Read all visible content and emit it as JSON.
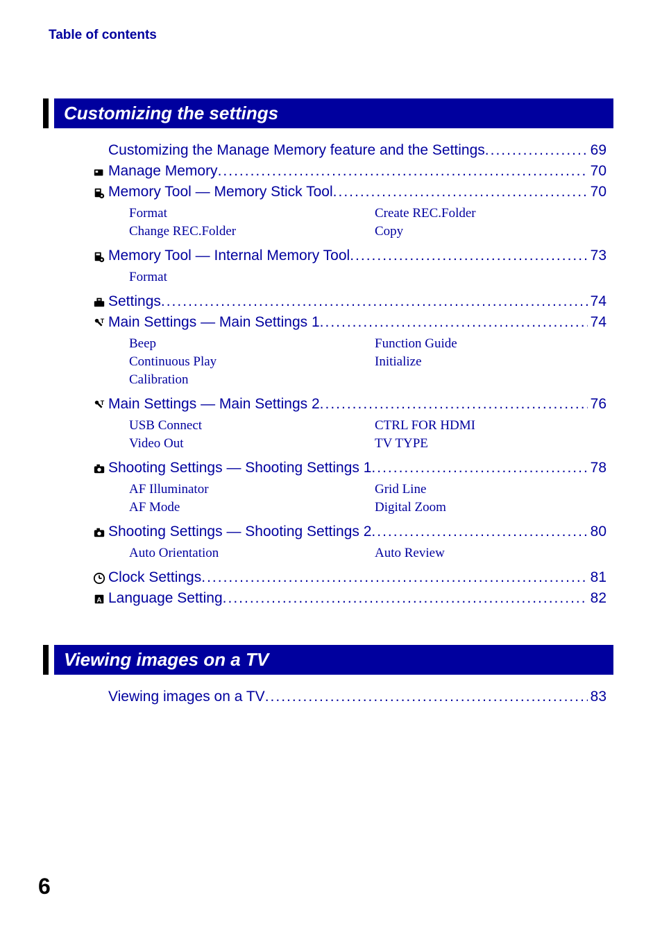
{
  "header": "Table of contents",
  "sections": [
    {
      "title": "Customizing the settings",
      "entries": [
        {
          "icon": "",
          "label": "Customizing the Manage Memory feature and the Settings",
          "page": "69",
          "link": true
        },
        {
          "icon": "memory-tab-icon",
          "label": "Manage Memory",
          "page": "70",
          "link": true
        },
        {
          "icon": "memory-tool-icon",
          "label": "Memory Tool — Memory Stick Tool",
          "page": "70",
          "link": true,
          "subs": [
            "Format",
            "Create REC.Folder",
            "Change REC.Folder",
            "Copy"
          ]
        },
        {
          "icon": "memory-tool-icon",
          "label": "Memory Tool — Internal Memory Tool",
          "page": "73",
          "link": true,
          "subs": [
            "Format",
            ""
          ]
        },
        {
          "icon": "toolbox-icon",
          "label": "Settings",
          "page": "74",
          "link": true
        },
        {
          "icon": "wrench-t-icon",
          "label": "Main Settings — Main Settings 1",
          "page": "74",
          "link": true,
          "subs": [
            "Beep",
            "Function Guide",
            "Continuous Play",
            "Initialize",
            "Calibration",
            ""
          ]
        },
        {
          "icon": "wrench-t-icon",
          "label": "Main Settings — Main Settings 2",
          "page": "76",
          "link": true,
          "subs": [
            "USB Connect",
            "CTRL FOR HDMI",
            "Video Out",
            "TV TYPE"
          ]
        },
        {
          "icon": "camera-icon",
          "label": "Shooting Settings — Shooting Settings 1",
          "page": "78",
          "link": true,
          "subs": [
            "AF Illuminator",
            "Grid Line",
            "AF Mode",
            "Digital Zoom"
          ]
        },
        {
          "icon": "camera-icon",
          "label": "Shooting Settings — Shooting Settings 2",
          "page": "80",
          "link": true,
          "subs": [
            "Auto Orientation",
            "Auto Review"
          ]
        },
        {
          "icon": "clock-icon",
          "label": "Clock Settings",
          "page": "81",
          "link": true
        },
        {
          "icon": "language-icon",
          "label": "Language Setting",
          "page": "82",
          "link": true
        }
      ]
    },
    {
      "title": "Viewing images on a TV",
      "entries": [
        {
          "icon": "",
          "label": "Viewing images on a TV",
          "page": "83",
          "link": true
        }
      ]
    }
  ],
  "page_number": "6"
}
